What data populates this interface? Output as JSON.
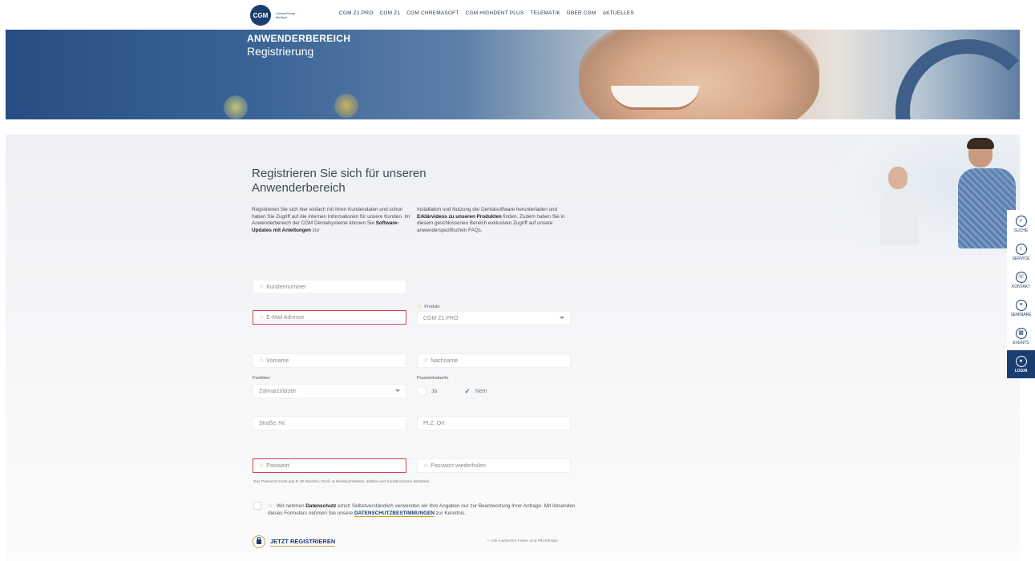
{
  "header": {
    "logo_text": "CGM",
    "logo_subtext": "CompuGroup Medical",
    "nav": [
      "CGM Z1.PRO",
      "CGM Z1",
      "CGM CHREMASOFT",
      "CGM HIGHDENT PLUS",
      "TELEMATIK",
      "ÜBER CGM",
      "AKTUELLES"
    ]
  },
  "hero": {
    "title": "ANWENDERBEREICH",
    "subtitle": "Registrierung"
  },
  "main": {
    "heading": "Registrieren Sie sich für unseren Anwenderbereich",
    "intro_left_1": "Registrieren Sie sich hier einfach mit Ihren Kundendaten und schon haben Sie Zugriff auf die internen Informationen für unsere Kunden. Im Anwenderbereich der CGM Dentalsysteme können Sie ",
    "intro_left_bold": "Software-Updates mit Anleitungen",
    "intro_left_2": " zur",
    "intro_right_1": "Installation und Nutzung der Dentalsoftware herunterladen und ",
    "intro_right_bold": "Erklärvideos zu unseren Produkten",
    "intro_right_2": " finden. Zudem haben Sie in diesem geschlossenen Bereich exklusiven Zugriff auf unsere anwenderspezifischen FAQs."
  },
  "form": {
    "star": "☆",
    "kundennummer": "Kundennummer",
    "email": "E-Mail Adresse",
    "produkt_label": "Produkt",
    "produkt_value": "CGM Z1.PRO",
    "vorname": "Vorname",
    "nachname": "Nachname",
    "funktion_label": "Funktion:",
    "funktion_value": "Zahnarzt/ärztin",
    "praxisinhaber_label": "Praxisinhaber/in",
    "ja": "Ja",
    "nein": "Nein",
    "strasse": "Straße, Nr.",
    "plz_ort": "PLZ, Ort",
    "passwort": "Passwort",
    "passwort_wdh": "Passwort wiederholen",
    "password_hint": "Das Passwort muss aus 8–20 Zeichen, Groß- & Kleinbuchstaben, Zahlen und Sonderzeichen bestehen.",
    "consent_1": " Wir nehmen ",
    "consent_bold": "Datenschutz",
    "consent_2": " ernst! Selbstverständlich verwenden wir Ihre Angaben nur zur Beantwortung Ihrer Anfrage. Mit Absenden dieses Formulars nehmen Sie unsere ",
    "consent_link": "DATENSCHUTZBESTIMMUNGEN",
    "consent_3": " zur Kenntnis.",
    "submit": "JETZT REGISTRIEREN",
    "required_note": "☆ Alle markierten Felder sind Pflichtfelder."
  },
  "sidebar": {
    "items": [
      {
        "label": "SUCHE",
        "glyph": "⌕"
      },
      {
        "label": "SERVICE",
        "glyph": "i"
      },
      {
        "label": "KONTAKT",
        "glyph": "☏"
      },
      {
        "label": "SEMINARE",
        "glyph": "≡"
      },
      {
        "label": "EVENTS",
        "glyph": "▦"
      },
      {
        "label": "LOGIN",
        "glyph": "●"
      }
    ]
  },
  "colors": {
    "brand_blue": "#1b3e70",
    "error_red": "#d7414f",
    "accent_gold": "#c2a23b"
  }
}
